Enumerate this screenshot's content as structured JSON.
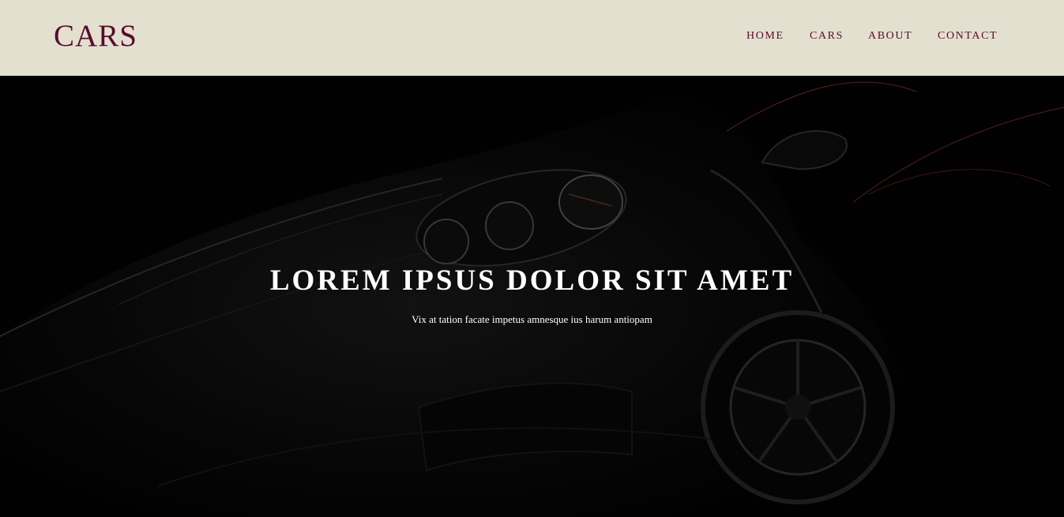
{
  "header": {
    "logo": "CARS",
    "nav": [
      {
        "label": "HOME"
      },
      {
        "label": "CARS"
      },
      {
        "label": "ABOUT"
      },
      {
        "label": "CONTACT"
      }
    ]
  },
  "hero": {
    "title": "LOREM IPSUS DOLOR SIT AMET",
    "subtitle": "Vix at tation facate impetus amnesque ius harum antiopam",
    "background_image": "car-photo"
  },
  "colors": {
    "header_bg": "#e3e0cf",
    "brand": "#5a0a2e",
    "hero_text": "#ffffff"
  }
}
